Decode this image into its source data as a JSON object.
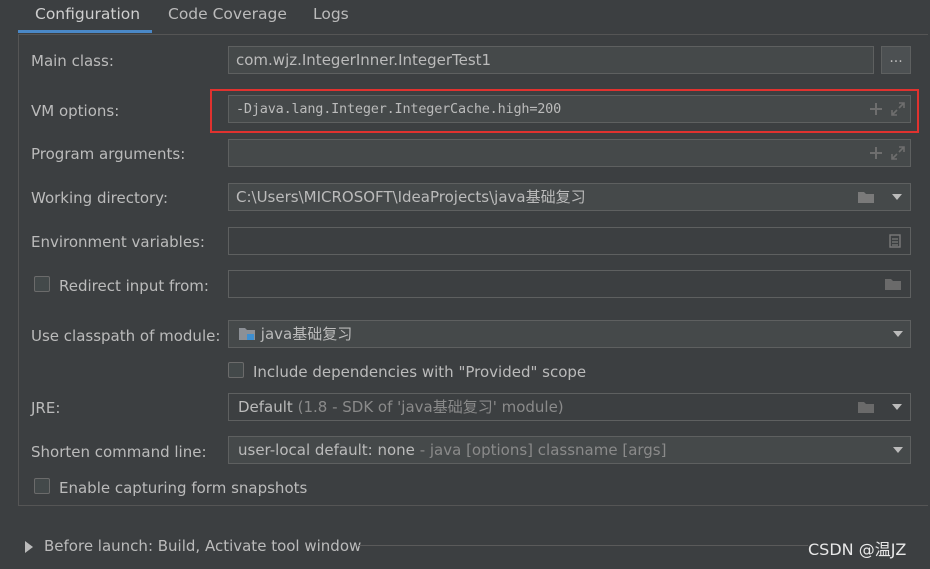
{
  "tabs": [
    {
      "label": "Configuration",
      "active": true
    },
    {
      "label": "Code Coverage",
      "active": false
    },
    {
      "label": "Logs",
      "active": false
    }
  ],
  "form": {
    "main_class": {
      "label": "Main class:",
      "value": "com.wjz.IntegerInner.IntegerTest1",
      "button": "..."
    },
    "vm_options": {
      "label": "VM options:",
      "value": "-Djava.lang.Integer.IntegerCache.high=200",
      "highlight_color": "#e0322f"
    },
    "program_arguments": {
      "label": "Program arguments:",
      "value": ""
    },
    "working_directory": {
      "label": "Working directory:",
      "value": "C:\\Users\\MICROSOFT\\IdeaProjects\\java基础复习"
    },
    "environment_variables": {
      "label": "Environment variables:",
      "value": ""
    },
    "redirect_input": {
      "label": "Redirect input from:",
      "checked": false,
      "value": ""
    },
    "classpath_module": {
      "label": "Use classpath of module:",
      "value": "java基础复习"
    },
    "include_provided": {
      "label": "Include dependencies with \"Provided\" scope",
      "checked": false
    },
    "jre": {
      "label": "JRE:",
      "value": "Default",
      "hint": "(1.8 - SDK of 'java基础复习' module)"
    },
    "shorten_command_line": {
      "label": "Shorten command line:",
      "value": "user-local default: none",
      "hint": "- java [options] classname [args]"
    },
    "capture_snapshots": {
      "label": "Enable capturing form snapshots",
      "checked": false
    }
  },
  "before_launch": {
    "label": "Before launch: Build, Activate tool window"
  },
  "watermark": "CSDN @温JZ",
  "colors": {
    "background": "#3c3f41",
    "field": "#45494a",
    "accent": "#4a88c7",
    "highlight": "#e0322f"
  }
}
